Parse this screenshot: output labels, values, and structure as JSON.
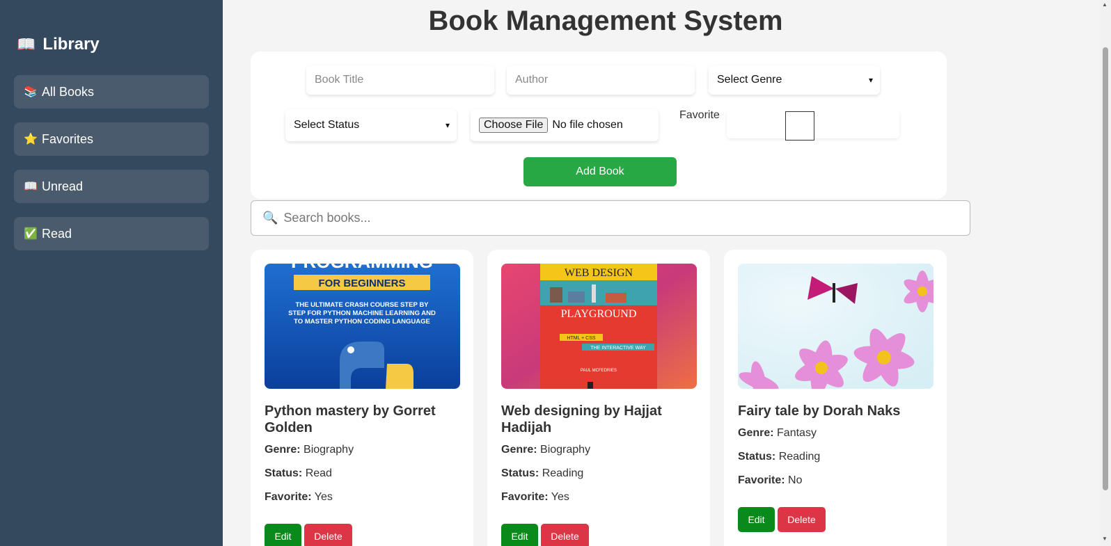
{
  "sidebar": {
    "title": "Library",
    "title_icon": "📖",
    "items": [
      {
        "icon": "📚",
        "label": "All Books"
      },
      {
        "icon": "⭐",
        "label": "Favorites"
      },
      {
        "icon": "📖",
        "label": "Unread"
      },
      {
        "icon": "✅",
        "label": "Read"
      }
    ]
  },
  "main": {
    "page_title": "Book Management System",
    "form": {
      "title_placeholder": "Book Title",
      "author_placeholder": "Author",
      "genre_select": "Select Genre",
      "status_select": "Select Status",
      "file_button": "Choose File",
      "file_status": "No file chosen",
      "favorite_label": "Favorite",
      "add_button": "Add Book"
    },
    "search": {
      "icon": "🔍",
      "placeholder": "Search books..."
    },
    "books": [
      {
        "title": "Python mastery by Gorret Golden",
        "genre_label": "Genre:",
        "genre": "Biography",
        "status_label": "Status:",
        "status": "Read",
        "favorite_label": "Favorite:",
        "favorite": "Yes",
        "edit": "Edit",
        "delete": "Delete",
        "cover_lines": [
          "PROGRAMMING",
          "FOR BEGINNERS",
          "THE ULTIMATE CRASH COURSE STEP BY",
          "STEP FOR PYTHON MACHINE LEARNING AND",
          "TO MASTER PYTHON CODING LANGUAGE"
        ]
      },
      {
        "title": "Web designing by Hajjat Hadijah",
        "genre_label": "Genre:",
        "genre": "Biography",
        "status_label": "Status:",
        "status": "Reading",
        "favorite_label": "Favorite:",
        "favorite": "Yes",
        "edit": "Edit",
        "delete": "Delete",
        "cover_lines": [
          "WEB DESIGN",
          "PLAYGROUND",
          "HTML + CSS",
          "THE INTERACTIVE WAY",
          "PAUL MCFEDRIES"
        ]
      },
      {
        "title": "Fairy tale by Dorah Naks",
        "genre_label": "Genre:",
        "genre": "Fantasy",
        "status_label": "Status:",
        "status": "Reading",
        "favorite_label": "Favorite:",
        "favorite": "No",
        "edit": "Edit",
        "delete": "Delete"
      }
    ]
  },
  "colors": {
    "sidebar_bg": "#34495e",
    "nav_item_bg": "#4a5b6d",
    "add_button": "#28a745",
    "edit_button": "#0a8a1a",
    "delete_button": "#dc3545"
  }
}
